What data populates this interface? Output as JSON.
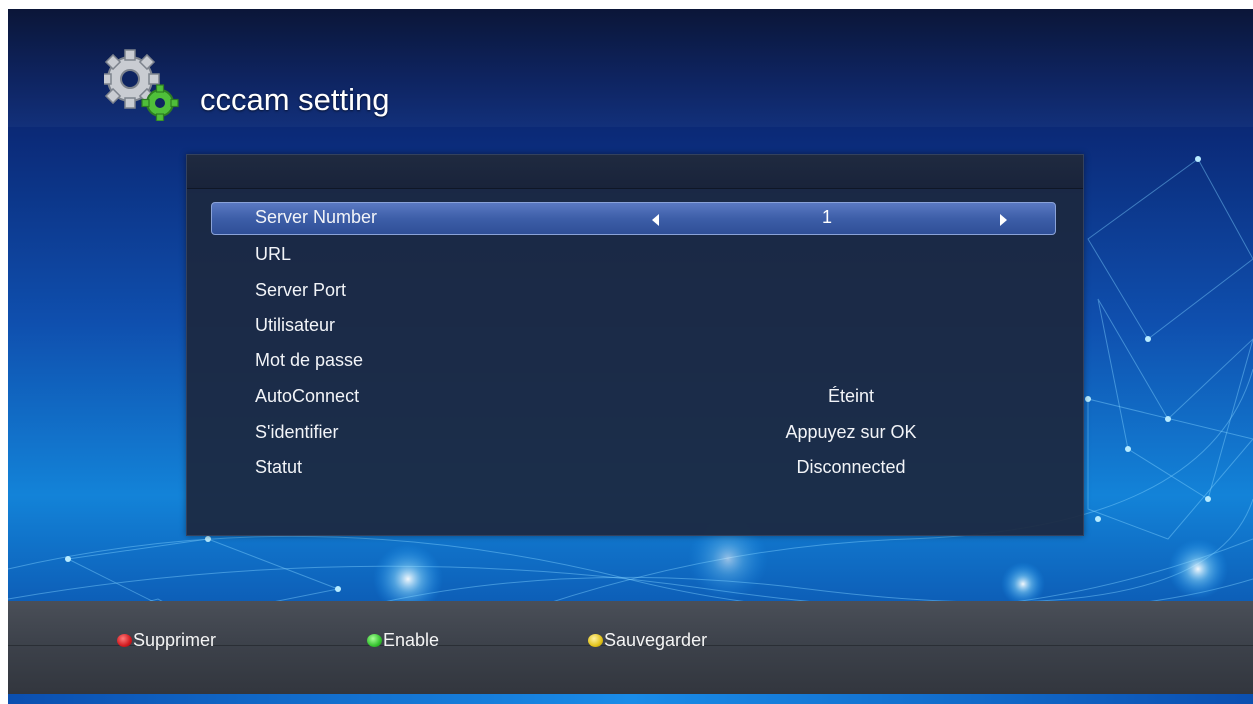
{
  "screen": {
    "title": "cccam setting"
  },
  "menu": {
    "selected": {
      "label": "Server Number",
      "value": "1"
    },
    "items": [
      {
        "label": "URL",
        "value": ""
      },
      {
        "label": "Server Port",
        "value": ""
      },
      {
        "label": "Utilisateur",
        "value": ""
      },
      {
        "label": "Mot de passe",
        "value": ""
      },
      {
        "label": "AutoConnect",
        "value": "Éteint"
      },
      {
        "label": "S'identifier",
        "value": "Appuyez sur OK"
      },
      {
        "label": "Statut",
        "value": "Disconnected"
      }
    ]
  },
  "footer": {
    "red": {
      "label": "Supprimer",
      "color": "#e0242a"
    },
    "green": {
      "label": "Enable",
      "color": "#3ccf3a"
    },
    "yellow": {
      "label": "Sauvegarder",
      "color": "#e8c81c"
    }
  },
  "icons": {
    "title_icon": "gear-icon",
    "left_arrow": "arrow-left-icon",
    "right_arrow": "arrow-right-icon"
  }
}
